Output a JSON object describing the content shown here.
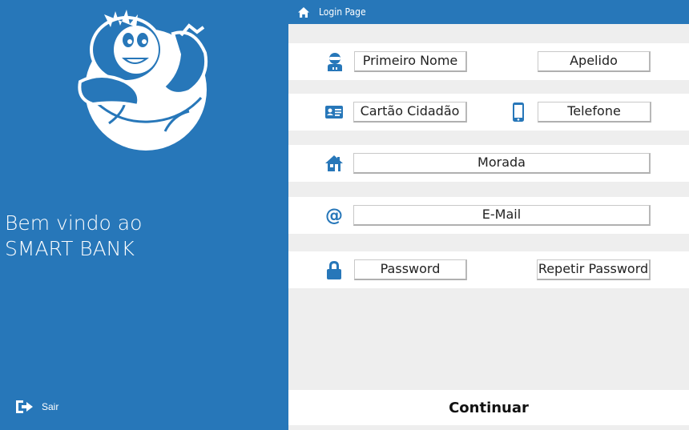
{
  "colors": {
    "brand_blue": "#2777b9",
    "panel_gray": "#eeeeee",
    "row_white": "#ffffff"
  },
  "sidebar": {
    "welcome_line1": "Bem vindo ao",
    "welcome_line2": "SMART BANK",
    "exit_label": "Sair",
    "exit_icon": "sign-out-icon",
    "logo": "bank-mascot-logo"
  },
  "header": {
    "title": "Login Page",
    "icon": "home-icon"
  },
  "form": {
    "first_name": {
      "placeholder": "Primeiro Nome",
      "icon": "user-icon"
    },
    "last_name": {
      "placeholder": "Apelido"
    },
    "citizen_card": {
      "placeholder": "Cartão Cidadão",
      "icon": "id-card-icon"
    },
    "phone": {
      "placeholder": "Telefone",
      "icon": "mobile-phone-icon"
    },
    "address": {
      "placeholder": "Morada",
      "icon": "house-icon"
    },
    "email": {
      "placeholder": "E-Mail",
      "icon": "at-sign-icon"
    },
    "password": {
      "placeholder": "Password",
      "icon": "lock-icon"
    },
    "repeat_password": {
      "placeholder": "Repetir Password"
    }
  },
  "footer": {
    "continue_label": "Continuar"
  }
}
